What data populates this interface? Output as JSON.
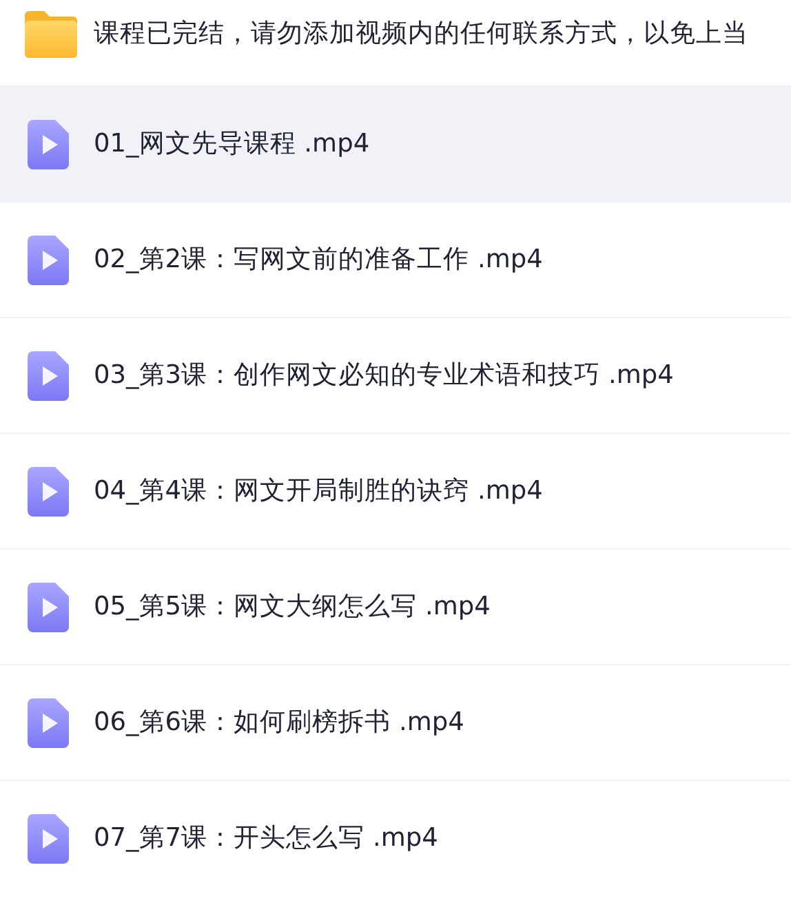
{
  "folder": {
    "name": "课程已完结，请勿添加视频内的任何联系方式，以免上当"
  },
  "files": [
    {
      "name": "01_网文先导课程 .mp4",
      "selected": true
    },
    {
      "name": "02_第2课：写网文前的准备工作 .mp4",
      "selected": false
    },
    {
      "name": "03_第3课：创作网文必知的专业术语和技巧 .mp4",
      "selected": false
    },
    {
      "name": "04_第4课：网文开局制胜的诀窍 .mp4",
      "selected": false
    },
    {
      "name": "05_第5课：网文大纲怎么写 .mp4",
      "selected": false
    },
    {
      "name": "06_第6课：如何刷榜拆书 .mp4",
      "selected": false
    },
    {
      "name": "07_第7课：开头怎么写 .mp4",
      "selected": false
    }
  ]
}
